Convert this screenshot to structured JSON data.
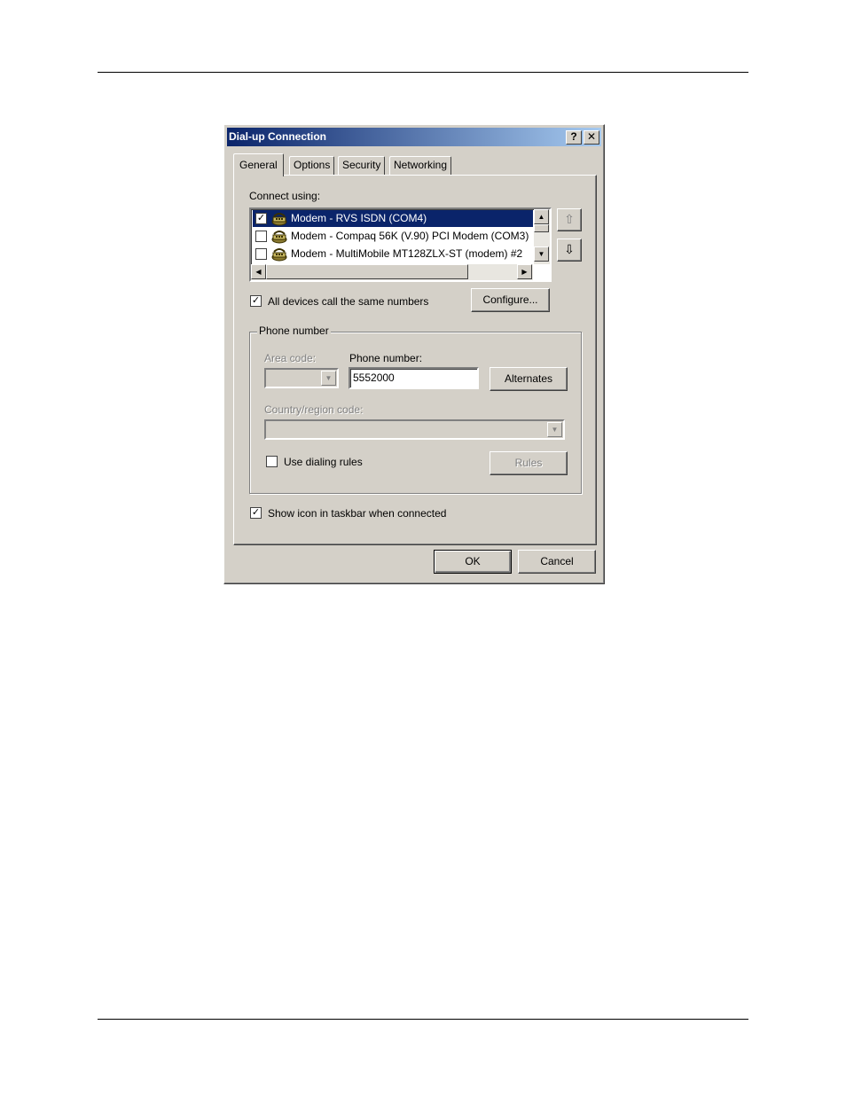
{
  "dialog": {
    "title": "Dial-up Connection",
    "help_glyph": "?",
    "close_glyph": "✕"
  },
  "tabs": [
    {
      "label": "General",
      "active": true
    },
    {
      "label": "Options"
    },
    {
      "label": "Security"
    },
    {
      "label": "Networking"
    }
  ],
  "connect": {
    "label": "Connect using:",
    "devices": [
      {
        "label": "Modem - RVS ISDN (COM4)",
        "checked": true,
        "selected": true,
        "icon": "modem-icon"
      },
      {
        "label": "Modem - Compaq 56K (V.90) PCI Modem (COM3)",
        "checked": false,
        "icon": "modem-icon"
      },
      {
        "label": "Modem - MultiMobile MT128ZLX-ST (modem) #2",
        "checked": false,
        "icon": "modem-icon"
      }
    ],
    "move_up_glyph": "⇧",
    "move_down_glyph": "⇩"
  },
  "same_numbers": {
    "label": "All devices call the same numbers",
    "checked": true
  },
  "configure_label": "Configure...",
  "phone_group": {
    "title": "Phone number",
    "area_code_label": "Area code:",
    "area_code_value": "",
    "phone_number_label": "Phone number:",
    "phone_number_value": "5552000",
    "alternates_label": "Alternates",
    "country_label": "Country/region code:",
    "country_value": "",
    "dialing_rules": {
      "label": "Use dialing rules",
      "checked": false
    },
    "rules_label": "Rules"
  },
  "show_icon": {
    "label": "Show icon in taskbar when connected",
    "checked": true
  },
  "ok_label": "OK",
  "cancel_label": "Cancel",
  "check_glyph": "✓",
  "colors": {
    "title_start": "#0a246a",
    "title_end": "#a6caf0",
    "face": "#d4d0c8",
    "selection": "#0a246a"
  }
}
